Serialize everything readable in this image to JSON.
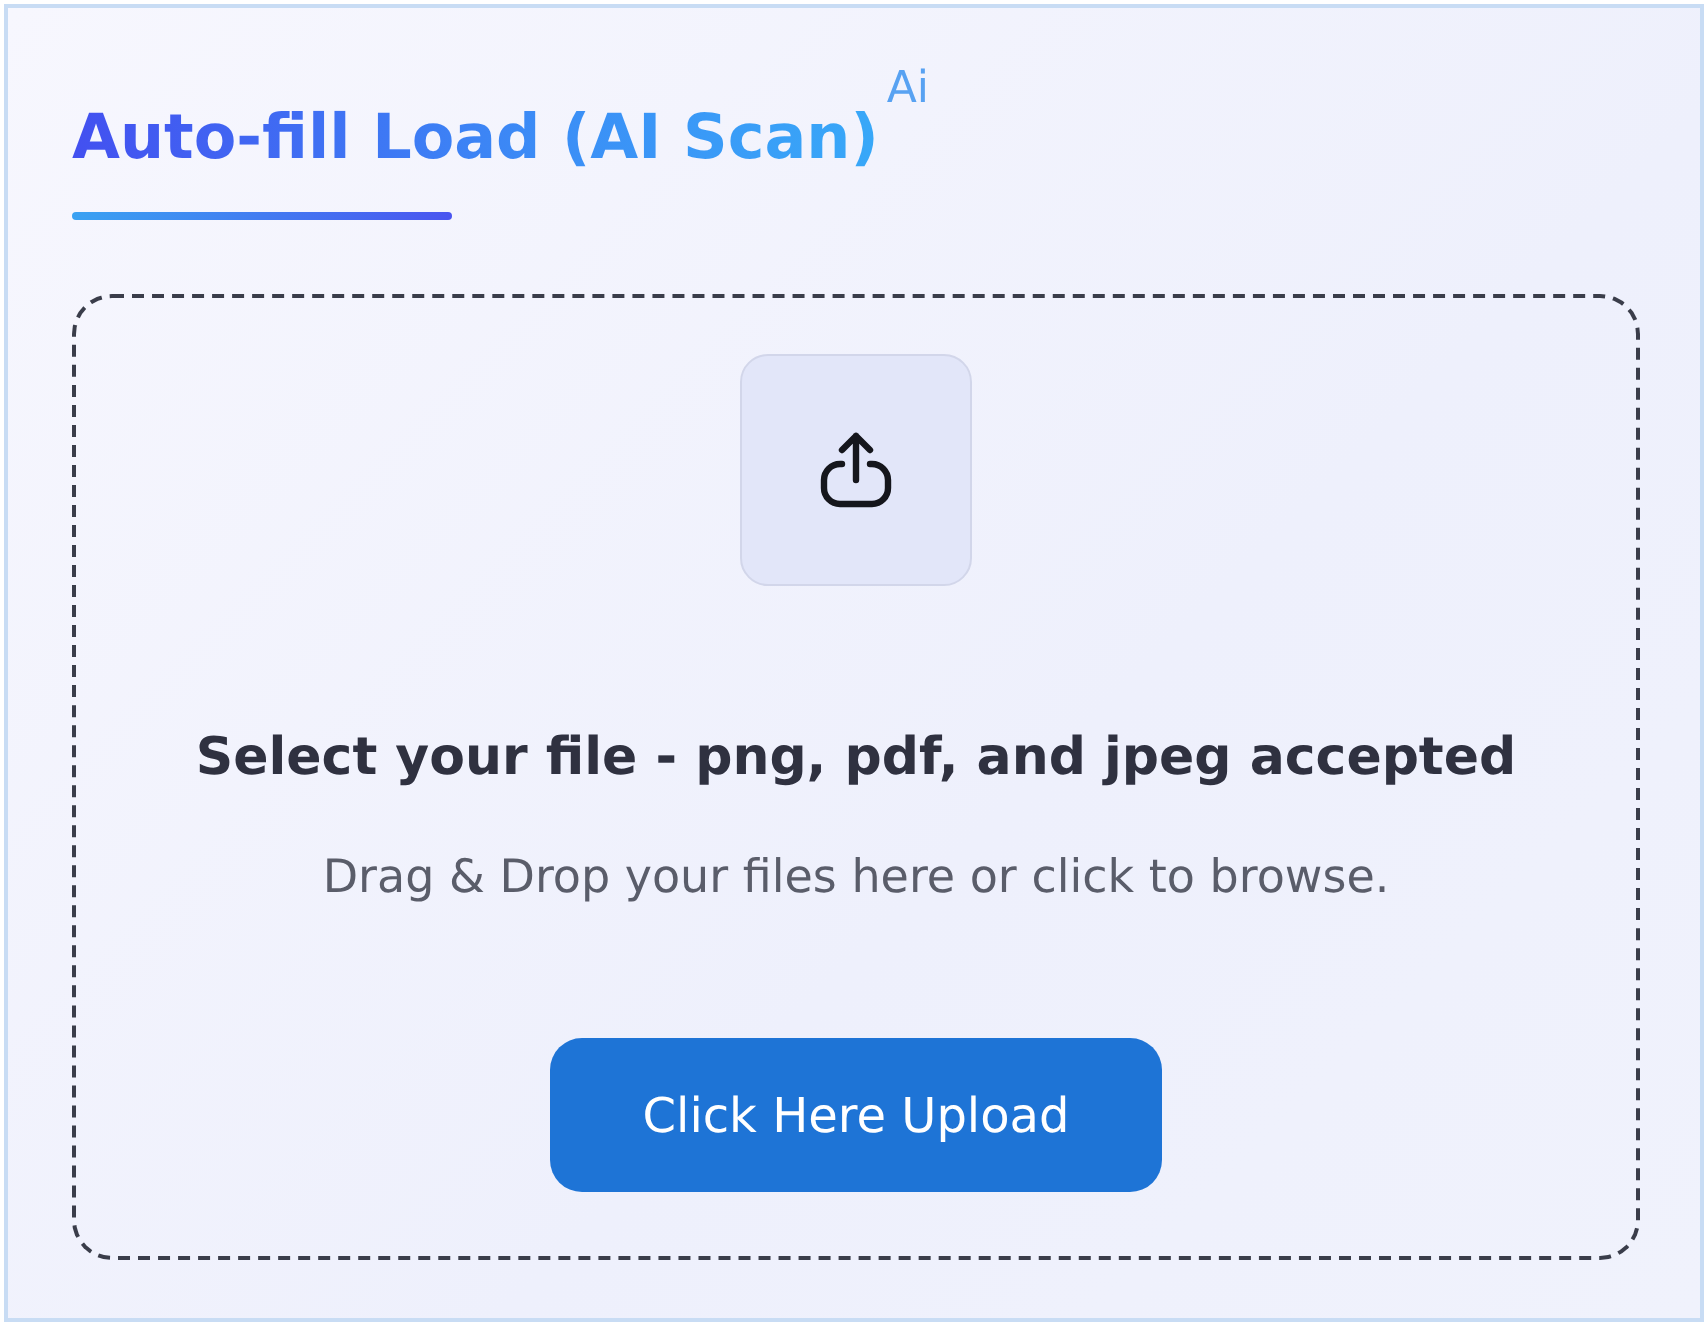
{
  "title": {
    "text": "Auto-fill Load (AI Scan)",
    "badge": "Ai"
  },
  "upload_zone": {
    "heading": "Select your file - png, pdf, and jpeg accepted",
    "hint": "Drag & Drop your files here or click to browse.",
    "button": "Click Here Upload"
  }
}
